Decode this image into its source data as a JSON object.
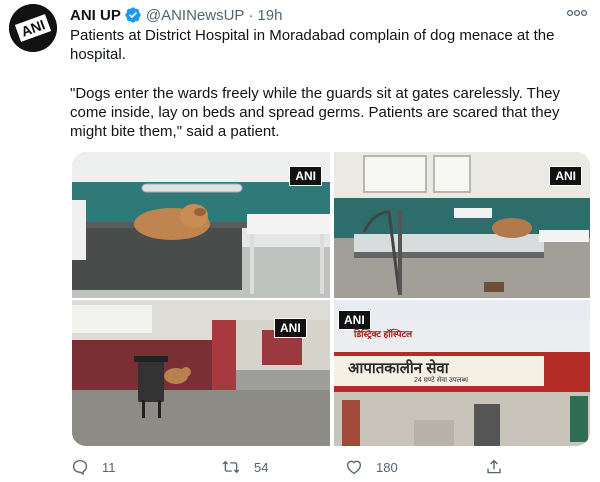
{
  "tweet": {
    "author_name": "ANI UP",
    "verified": true,
    "handle": "@ANINewsUP",
    "separator": "·",
    "time": "19h",
    "text_line1": "Patients at District Hospital in Moradabad complain of dog menace at the hospital.",
    "text_line2": "\"Dogs enter the wards freely while the guards sit at gates carelessly. They come inside, lay on beds and spread germs. Patients are scared that they might bite them,\" said a patient.",
    "avatar_logo": "ANI"
  },
  "media": {
    "badge": "ANI",
    "sign_line1": "डिस्ट्रिक्ट हॉस्पिटल",
    "sign_line2": "आपातकालीन सेवा",
    "sign_line3": "24 घण्टे सेवा उपलब्ध"
  },
  "actions": {
    "reply_count": "11",
    "retweet_count": "54",
    "like_count": "180"
  },
  "colors": {
    "verified": "#1d9bf0",
    "muted": "#536471",
    "text": "#0f1419"
  },
  "icons": [
    "verified-badge-icon",
    "more-options-icon",
    "reply-icon",
    "retweet-icon",
    "like-icon",
    "share-icon"
  ]
}
